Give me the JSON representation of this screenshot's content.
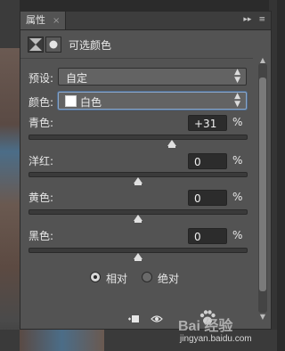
{
  "panel": {
    "tab_label": "属性",
    "tab_close": "×",
    "collapse_glyph": "▸▸",
    "menu_glyph": "≡"
  },
  "adjustment": {
    "title": "可选颜色",
    "preset_label": "预设:",
    "preset_value": "自定",
    "colors_label": "颜色:",
    "colors_value": "白色",
    "swatch_color": "#ffffff"
  },
  "sliders": [
    {
      "label": "青色:",
      "value": "+31",
      "unit": "%",
      "position": 0.655
    },
    {
      "label": "洋红:",
      "value": "0",
      "unit": "%",
      "position": 0.5
    },
    {
      "label": "黄色:",
      "value": "0",
      "unit": "%",
      "position": 0.5
    },
    {
      "label": "黑色:",
      "value": "0",
      "unit": "%",
      "position": 0.5
    }
  ],
  "method": {
    "relative_label": "相对",
    "absolute_label": "绝对",
    "selected": "relative"
  },
  "watermark": {
    "brand": "Bai  经验",
    "url": "jingyan.baidu.com"
  },
  "colors": {
    "panel_bg": "#535353",
    "accent_border": "#8aa6c8"
  }
}
